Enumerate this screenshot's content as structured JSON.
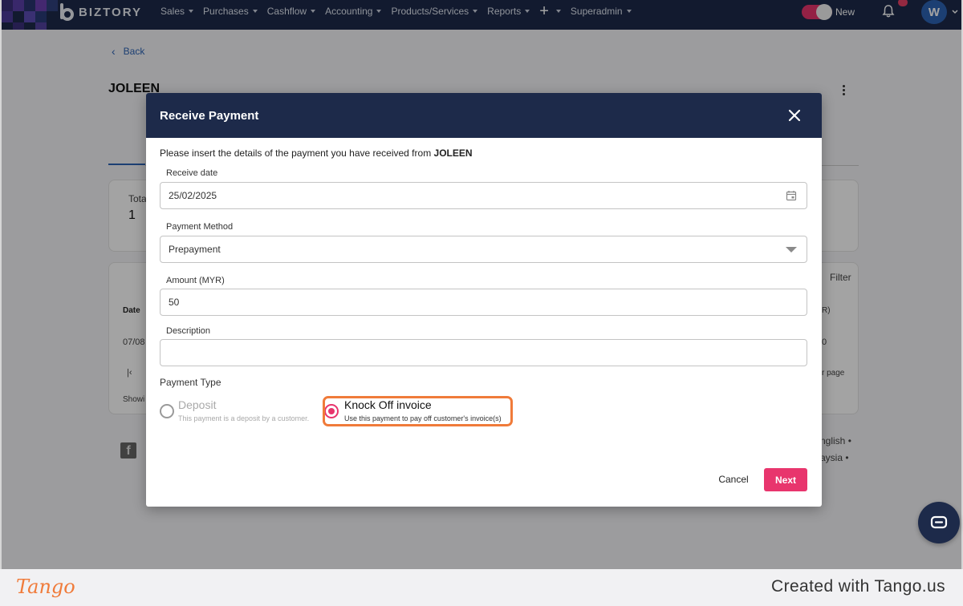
{
  "app": {
    "brand": "BIZTORY",
    "nav": [
      {
        "label": "Sales"
      },
      {
        "label": "Purchases"
      },
      {
        "label": "Cashflow"
      },
      {
        "label": "Accounting"
      },
      {
        "label": "Products/Services"
      },
      {
        "label": "Reports"
      },
      {
        "label": "+"
      },
      {
        "label": "Superadmin"
      }
    ],
    "toggle_label": "New",
    "avatar_initial": "W",
    "colors": {
      "nav_bg": "#1d2a4a",
      "accent": "#e8356d",
      "link": "#2d63b5",
      "highlight": "#f07b3a"
    }
  },
  "page": {
    "back_label": "Back",
    "customer_name": "JOLEEN",
    "summary_label_partial": "Tota",
    "summary_value": "1",
    "filter_label": "Filter",
    "table": {
      "header_date": "Date",
      "header_partial": "R)",
      "row_date_partial": "07/08",
      "row_value_partial": "0"
    },
    "pagination_partial": "r page",
    "showing_partial": "Showi",
    "footer_lang_partial": "nglish •",
    "footer_country_partial": "aysia •"
  },
  "modal": {
    "title": "Receive Payment",
    "intro_text": "Please insert the details of the payment you have received from ",
    "intro_customer": "JOLEEN",
    "receive_date": {
      "label": "Receive date",
      "value": "25/02/2025"
    },
    "payment_method": {
      "label": "Payment Method",
      "value": "Prepayment"
    },
    "amount": {
      "label": "Amount (MYR)",
      "value": "50"
    },
    "description": {
      "label": "Description",
      "value": ""
    },
    "payment_type": {
      "label": "Payment Type",
      "options": [
        {
          "title": "Deposit",
          "desc": "This payment is a deposit by a customer.",
          "selected": false
        },
        {
          "title": "Knock Off invoice",
          "desc": "Use this payment to pay off customer's invoice(s)",
          "selected": true
        }
      ]
    },
    "cancel_label": "Cancel",
    "next_label": "Next"
  },
  "footer": {
    "logo_text": "Tango",
    "created_text": "Created with Tango.us"
  }
}
